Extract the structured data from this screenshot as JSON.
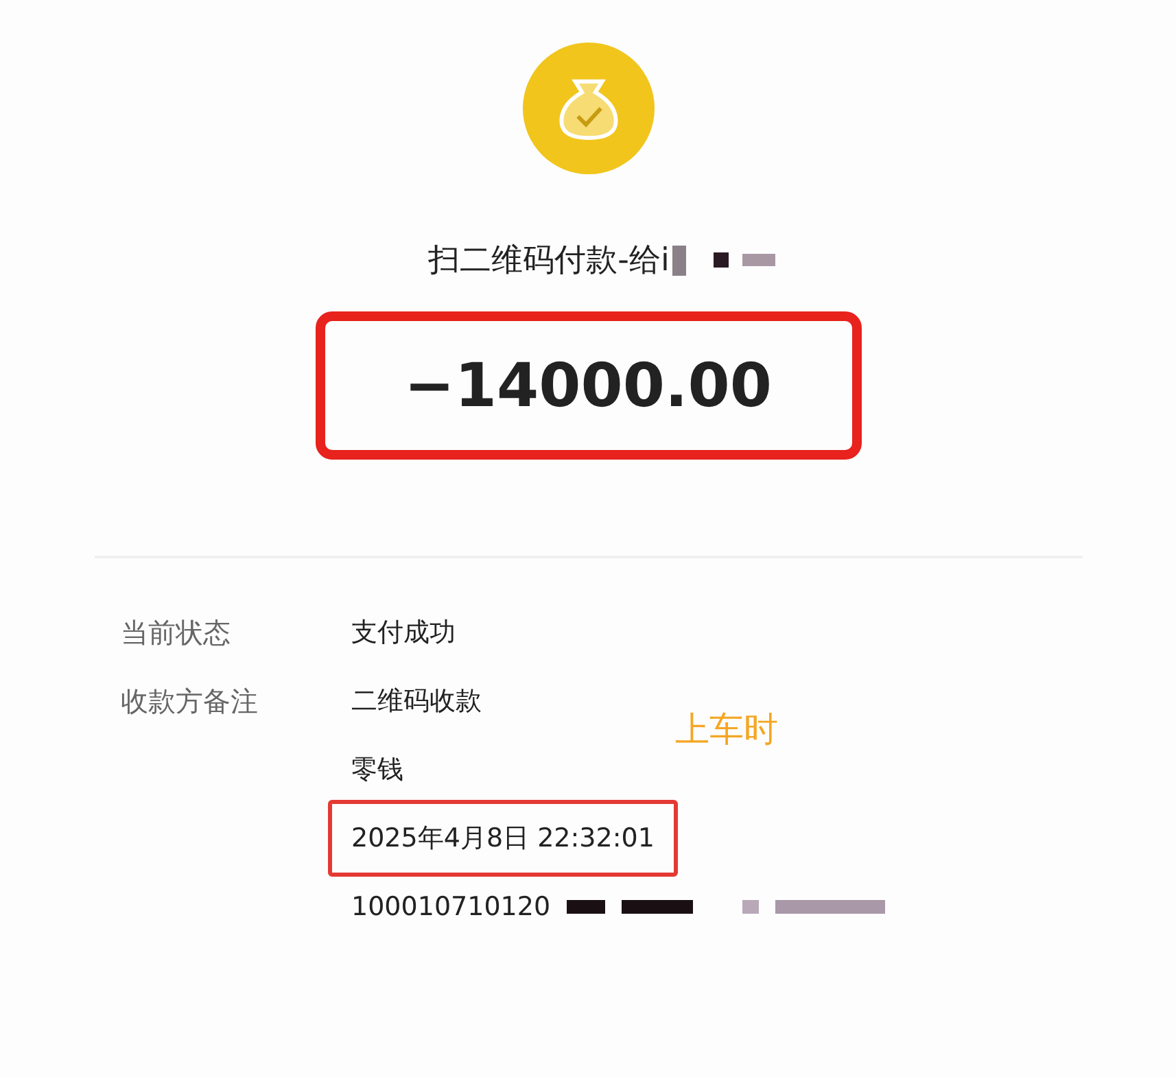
{
  "payee_title": "扫二维码付款-给i",
  "amount": {
    "text": "−14000.00",
    "highlighted": true
  },
  "details": [
    {
      "label": "当前状态",
      "value": "支付成功",
      "highlighted": false
    },
    {
      "label": "收款方备注",
      "value": "二维码收款",
      "highlighted": false
    },
    {
      "value": "零钱",
      "highlighted": false
    },
    {
      "value": "2025年4月8日 22:32:01",
      "highlighted": true
    },
    {
      "value": "100010710120",
      "highlighted": false,
      "redacted": true
    }
  ],
  "annotation": {
    "text": "上车时",
    "color": "#f5a623"
  }
}
